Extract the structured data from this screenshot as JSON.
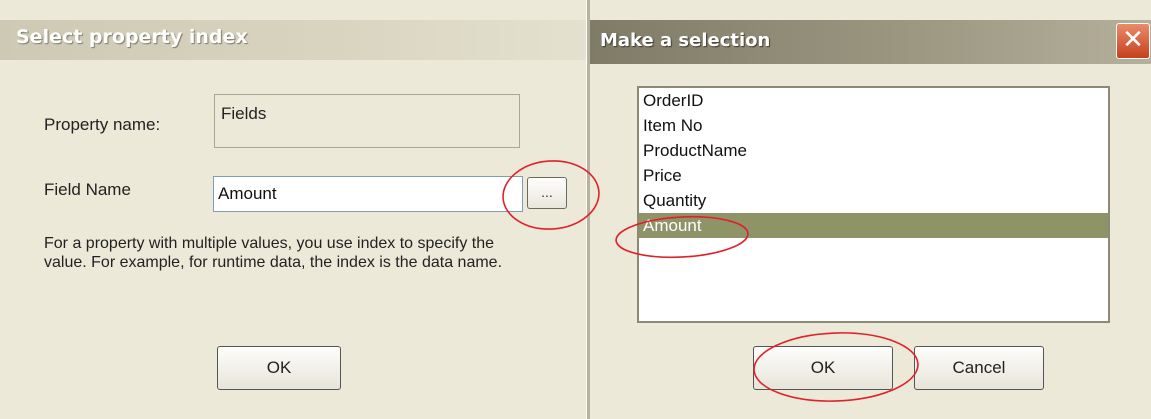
{
  "top_strip": {
    "text": "· · · · · · · · · · ·"
  },
  "select_property_dialog": {
    "title": "Select property index",
    "property_name_label": "Property name:",
    "property_name_value": "Fields",
    "field_name_label": "Field Name",
    "field_name_value": "Amount",
    "browse_button_label": "...",
    "description": "For a property with multiple values, you use index to specify the value. For example, for runtime data, the index is the data name.",
    "ok_label": "OK"
  },
  "selection_dialog": {
    "title": "Make a selection",
    "close_icon_glyph": "✕",
    "list_items": [
      {
        "label": "OrderID"
      },
      {
        "label": "Item No"
      },
      {
        "label": "ProductName"
      },
      {
        "label": "Price"
      },
      {
        "label": "Quantity"
      },
      {
        "label": "Amount",
        "selected": true
      }
    ],
    "ok_label": "OK",
    "cancel_label": "Cancel"
  },
  "colors": {
    "dialog_bg": "#ece9d8",
    "selection_highlight": "#8f9468",
    "annotation_circle": "#e0212b"
  },
  "annotations": [
    "red-circle-browse-button",
    "red-circle-amount-item",
    "red-circle-ok-button"
  ]
}
